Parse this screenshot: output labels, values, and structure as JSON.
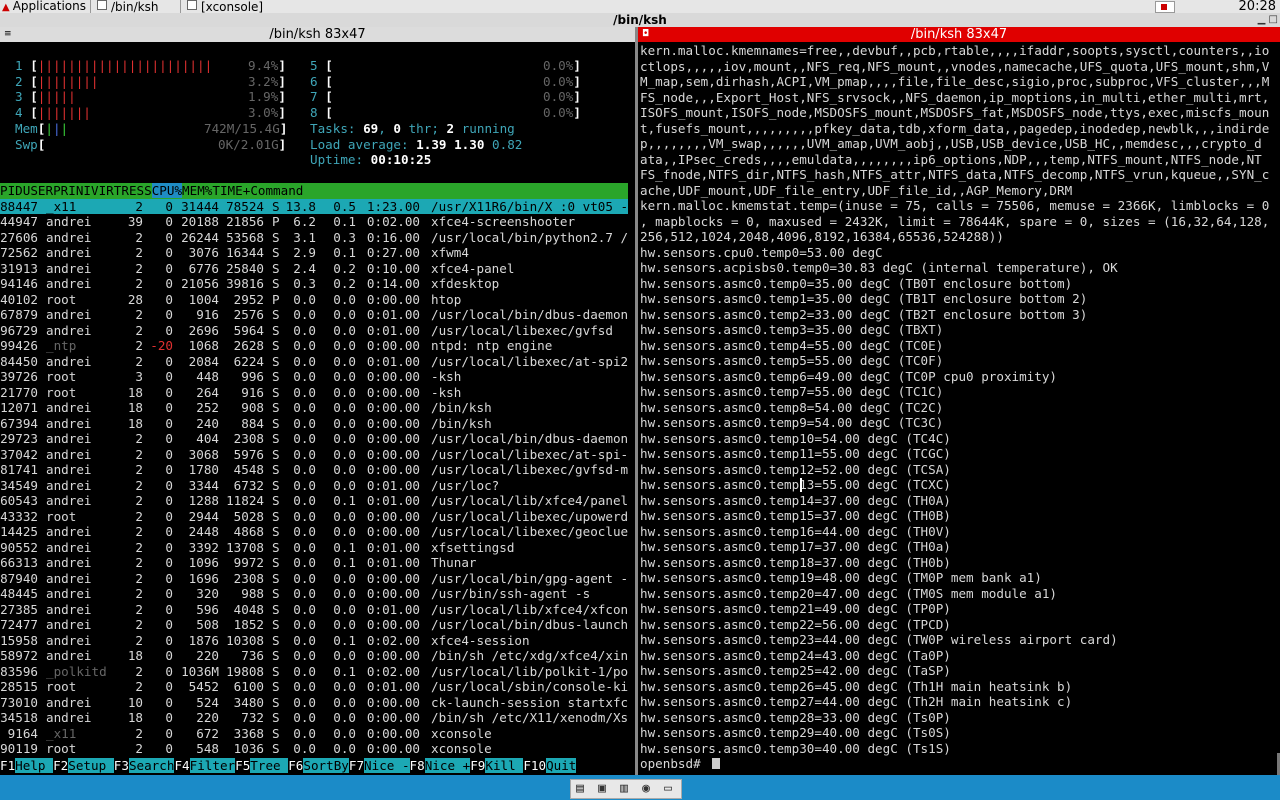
{
  "topbar": {
    "applications": "Applications",
    "tabs": [
      "/bin/ksh",
      "[xconsole]"
    ],
    "clock": "20:28"
  },
  "window": {
    "title": "/bin/ksh",
    "left_title": "/bin/ksh 83x47",
    "right_title": "/bin/ksh 83x47"
  },
  "htop": {
    "cpus": [
      {
        "n": "1",
        "pct": "9.4%"
      },
      {
        "n": "2",
        "pct": "3.2%"
      },
      {
        "n": "3",
        "pct": "1.9%"
      },
      {
        "n": "4",
        "pct": "3.0%"
      },
      {
        "n": "5",
        "pct": "0.0%"
      },
      {
        "n": "6",
        "pct": "0.0%"
      },
      {
        "n": "7",
        "pct": "0.0%"
      },
      {
        "n": "8",
        "pct": "0.0%"
      }
    ],
    "mem_label": "Mem",
    "mem_val": "742M/15.4G",
    "swp_label": "Swp",
    "swp_val": "0K/2.01G",
    "tasks_label": "Tasks: ",
    "tasks": "69",
    "thr": "0",
    "thr_label": " thr; ",
    "running": "2",
    "running_label": " running",
    "load_label": "Load average: ",
    "load1": "1.39",
    "load5": "1.30",
    "load15": "0.82",
    "uptime_label": "Uptime: ",
    "uptime": "00:10:25",
    "columns": [
      "PID",
      "USER",
      "PRI",
      "NI",
      "VIRT",
      "RES",
      "S",
      "CPU%",
      "MEM%",
      "TIME+",
      "Command"
    ],
    "rows": [
      [
        "88447",
        "_x11",
        "2",
        "0",
        "31444",
        "78524",
        "S",
        "13.8",
        "0.5",
        "1:23.00",
        "/usr/X11R6/bin/X :0 vt05 -"
      ],
      [
        "44947",
        "andrei",
        "39",
        "0",
        "20188",
        "21856",
        "P",
        "6.2",
        "0.1",
        "0:02.00",
        "xfce4-screenshooter"
      ],
      [
        "27606",
        "andrei",
        "2",
        "0",
        "26244",
        "53568",
        "S",
        "3.1",
        "0.3",
        "0:16.00",
        "/usr/local/bin/python2.7 /"
      ],
      [
        "72562",
        "andrei",
        "2",
        "0",
        "3076",
        "16344",
        "S",
        "2.9",
        "0.1",
        "0:27.00",
        "xfwm4"
      ],
      [
        "31913",
        "andrei",
        "2",
        "0",
        "6776",
        "25840",
        "S",
        "2.4",
        "0.2",
        "0:10.00",
        "xfce4-panel"
      ],
      [
        "94146",
        "andrei",
        "2",
        "0",
        "21056",
        "39816",
        "S",
        "0.3",
        "0.2",
        "0:14.00",
        "xfdesktop"
      ],
      [
        "40102",
        "root",
        "28",
        "0",
        "1004",
        "2952",
        "P",
        "0.0",
        "0.0",
        "0:00.00",
        "htop"
      ],
      [
        "67879",
        "andrei",
        "2",
        "0",
        "916",
        "2576",
        "S",
        "0.0",
        "0.0",
        "0:01.00",
        "/usr/local/bin/dbus-daemon"
      ],
      [
        "96729",
        "andrei",
        "2",
        "0",
        "2696",
        "5964",
        "S",
        "0.0",
        "0.0",
        "0:01.00",
        "/usr/local/libexec/gvfsd"
      ],
      [
        "99426",
        "_ntp",
        "2",
        "-20",
        "1068",
        "2628",
        "S",
        "0.0",
        "0.0",
        "0:00.00",
        "ntpd: ntp engine"
      ],
      [
        "84450",
        "andrei",
        "2",
        "0",
        "2084",
        "6224",
        "S",
        "0.0",
        "0.0",
        "0:01.00",
        "/usr/local/libexec/at-spi2"
      ],
      [
        "39726",
        "root",
        "3",
        "0",
        "448",
        "996",
        "S",
        "0.0",
        "0.0",
        "0:00.00",
        "-ksh"
      ],
      [
        "21770",
        "root",
        "18",
        "0",
        "264",
        "916",
        "S",
        "0.0",
        "0.0",
        "0:00.00",
        "-ksh"
      ],
      [
        "12071",
        "andrei",
        "18",
        "0",
        "252",
        "908",
        "S",
        "0.0",
        "0.0",
        "0:00.00",
        "/bin/ksh"
      ],
      [
        "67394",
        "andrei",
        "18",
        "0",
        "240",
        "884",
        "S",
        "0.0",
        "0.0",
        "0:00.00",
        "/bin/ksh"
      ],
      [
        "29723",
        "andrei",
        "2",
        "0",
        "404",
        "2308",
        "S",
        "0.0",
        "0.0",
        "0:00.00",
        "/usr/local/bin/dbus-daemon"
      ],
      [
        "37042",
        "andrei",
        "2",
        "0",
        "3068",
        "5976",
        "S",
        "0.0",
        "0.0",
        "0:00.00",
        "/usr/local/libexec/at-spi-"
      ],
      [
        "81741",
        "andrei",
        "2",
        "0",
        "1780",
        "4548",
        "S",
        "0.0",
        "0.0",
        "0:00.00",
        "/usr/local/libexec/gvfsd-m"
      ],
      [
        "34549",
        "andrei",
        "2",
        "0",
        "3344",
        "6732",
        "S",
        "0.0",
        "0.0",
        "0:01.00",
        "/usr/loc?"
      ],
      [
        "60543",
        "andrei",
        "2",
        "0",
        "1288",
        "11824",
        "S",
        "0.0",
        "0.1",
        "0:01.00",
        "/usr/local/lib/xfce4/panel"
      ],
      [
        "43332",
        "root",
        "2",
        "0",
        "2944",
        "5028",
        "S",
        "0.0",
        "0.0",
        "0:00.00",
        "/usr/local/libexec/upowerd"
      ],
      [
        "14425",
        "andrei",
        "2",
        "0",
        "2448",
        "4868",
        "S",
        "0.0",
        "0.0",
        "0:00.00",
        "/usr/local/libexec/geoclue"
      ],
      [
        "90552",
        "andrei",
        "2",
        "0",
        "3392",
        "13708",
        "S",
        "0.0",
        "0.1",
        "0:01.00",
        "xfsettingsd"
      ],
      [
        "66313",
        "andrei",
        "2",
        "0",
        "1096",
        "9972",
        "S",
        "0.0",
        "0.1",
        "0:01.00",
        "Thunar"
      ],
      [
        "87940",
        "andrei",
        "2",
        "0",
        "1696",
        "2308",
        "S",
        "0.0",
        "0.0",
        "0:00.00",
        "/usr/local/bin/gpg-agent -"
      ],
      [
        "48445",
        "andrei",
        "2",
        "0",
        "320",
        "988",
        "S",
        "0.0",
        "0.0",
        "0:00.00",
        "/usr/bin/ssh-agent -s"
      ],
      [
        "27385",
        "andrei",
        "2",
        "0",
        "596",
        "4048",
        "S",
        "0.0",
        "0.0",
        "0:01.00",
        "/usr/local/lib/xfce4/xfcon"
      ],
      [
        "72477",
        "andrei",
        "2",
        "0",
        "508",
        "1852",
        "S",
        "0.0",
        "0.0",
        "0:00.00",
        "/usr/local/bin/dbus-launch"
      ],
      [
        "15958",
        "andrei",
        "2",
        "0",
        "1876",
        "10308",
        "S",
        "0.0",
        "0.1",
        "0:02.00",
        "xfce4-session"
      ],
      [
        "58972",
        "andrei",
        "18",
        "0",
        "220",
        "736",
        "S",
        "0.0",
        "0.0",
        "0:00.00",
        "/bin/sh /etc/xdg/xfce4/xin"
      ],
      [
        "83596",
        "_polkitd",
        "2",
        "0",
        "1036M",
        "19808",
        "S",
        "0.0",
        "0.1",
        "0:02.00",
        "/usr/local/lib/polkit-1/po"
      ],
      [
        "28515",
        "root",
        "2",
        "0",
        "5452",
        "6100",
        "S",
        "0.0",
        "0.0",
        "0:01.00",
        "/usr/local/sbin/console-ki"
      ],
      [
        "73010",
        "andrei",
        "10",
        "0",
        "524",
        "3480",
        "S",
        "0.0",
        "0.0",
        "0:00.00",
        "ck-launch-session startxfc"
      ],
      [
        "34518",
        "andrei",
        "18",
        "0",
        "220",
        "732",
        "S",
        "0.0",
        "0.0",
        "0:00.00",
        "/bin/sh /etc/X11/xenodm/Xs"
      ],
      [
        "9164",
        "_x11",
        "2",
        "0",
        "672",
        "3368",
        "S",
        "0.0",
        "0.0",
        "0:00.00",
        "xconsole"
      ],
      [
        "90119",
        "root",
        "2",
        "0",
        "548",
        "1036",
        "S",
        "0.0",
        "0.0",
        "0:00.00",
        "xconsole"
      ]
    ],
    "fkeys": [
      {
        "k": "F1",
        "l": "Help  "
      },
      {
        "k": "F2",
        "l": "Setup "
      },
      {
        "k": "F3",
        "l": "Search"
      },
      {
        "k": "F4",
        "l": "Filter"
      },
      {
        "k": "F5",
        "l": "Tree  "
      },
      {
        "k": "F6",
        "l": "SortBy"
      },
      {
        "k": "F7",
        "l": "Nice -"
      },
      {
        "k": "F8",
        "l": "Nice +"
      },
      {
        "k": "F9",
        "l": "Kill  "
      },
      {
        "k": "F10",
        "l": "Quit  "
      }
    ]
  },
  "console_lines": [
    "kern.malloc.kmemnames=free,,devbuf,,pcb,rtable,,,,ifaddr,soopts,sysctl,counters,,io",
    "ctlops,,,,,iov,mount,,NFS_req,NFS_mount,,vnodes,namecache,UFS_quota,UFS_mount,shm,V",
    "M_map,sem,dirhash,ACPI,VM_pmap,,,,file,file_desc,sigio,proc,subproc,VFS_cluster,,,M",
    "FS_node,,,Export_Host,NFS_srvsock,,NFS_daemon,ip_moptions,in_multi,ether_multi,mrt,",
    "ISOFS_mount,ISOFS_node,MSDOSFS_mount,MSDOSFS_fat,MSDOSFS_node,ttys,exec,miscfs_moun",
    "t,fusefs_mount,,,,,,,,,pfkey_data,tdb,xform_data,,pagedep,inodedep,newblk,,,indirde",
    "p,,,,,,,,VM_swap,,,,,,UVM_amap,UVM_aobj,,USB,USB_device,USB_HC,,memdesc,,,crypto_d",
    "ata,,IPsec_creds,,,,emuldata,,,,,,,,ip6_options,NDP,,,temp,NTFS_mount,NTFS_node,NT",
    "FS_fnode,NTFS_dir,NTFS_hash,NTFS_attr,NTFS_data,NTFS_decomp,NTFS_vrun,kqueue,,SYN_c",
    "ache,UDF_mount,UDF_file_entry,UDF_file_id,,AGP_Memory,DRM",
    "kern.malloc.kmemstat.temp=(inuse = 75, calls = 75506, memuse = 2366K, limblocks = 0",
    ", mapblocks = 0, maxused = 2432K, limit = 78644K, spare = 0, sizes = (16,32,64,128,",
    "256,512,1024,2048,4096,8192,16384,65536,524288))",
    "hw.sensors.cpu0.temp0=53.00 degC",
    "hw.sensors.acpisbs0.temp0=30.83 degC (internal temperature), OK",
    "hw.sensors.asmc0.temp0=35.00 degC (TB0T enclosure bottom)",
    "hw.sensors.asmc0.temp1=35.00 degC (TB1T enclosure bottom 2)",
    "hw.sensors.asmc0.temp2=33.00 degC (TB2T enclosure bottom 3)",
    "hw.sensors.asmc0.temp3=35.00 degC (TBXT)",
    "hw.sensors.asmc0.temp4=55.00 degC (TC0E)",
    "hw.sensors.asmc0.temp5=55.00 degC (TC0F)",
    "hw.sensors.asmc0.temp6=49.00 degC (TC0P cpu0 proximity)",
    "hw.sensors.asmc0.temp7=55.00 degC (TC1C)",
    "hw.sensors.asmc0.temp8=54.00 degC (TC2C)",
    "hw.sensors.asmc0.temp9=54.00 degC (TC3C)",
    "hw.sensors.asmc0.temp10=54.00 degC (TC4C)",
    "hw.sensors.asmc0.temp11=55.00 degC (TCGC)",
    "hw.sensors.asmc0.temp12=52.00 degC (TCSA)",
    "hw.sensors.asmc0.temp13=55.00 degC (TCXC)",
    "hw.sensors.asmc0.temp14=37.00 degC (TH0A)",
    "hw.sensors.asmc0.temp15=37.00 degC (TH0B)",
    "hw.sensors.asmc0.temp16=44.00 degC (TH0V)",
    "hw.sensors.asmc0.temp17=37.00 degC (TH0a)",
    "hw.sensors.asmc0.temp18=37.00 degC (TH0b)",
    "hw.sensors.asmc0.temp19=48.00 degC (TM0P mem bank a1)",
    "hw.sensors.asmc0.temp20=47.00 degC (TM0S mem module a1)",
    "hw.sensors.asmc0.temp21=49.00 degC (TP0P)",
    "hw.sensors.asmc0.temp22=56.00 degC (TPCD)",
    "hw.sensors.asmc0.temp23=44.00 degC (TW0P wireless airport card)",
    "hw.sensors.asmc0.temp24=43.00 degC (Ta0P)",
    "hw.sensors.asmc0.temp25=42.00 degC (TaSP)",
    "hw.sensors.asmc0.temp26=45.00 degC (Th1H main heatsink b)",
    "hw.sensors.asmc0.temp27=44.00 degC (Th2H main heatsink c)",
    "hw.sensors.asmc0.temp28=33.00 degC (Ts0P)",
    "hw.sensors.asmc0.temp29=40.00 degC (Ts0S)",
    "hw.sensors.asmc0.temp30=40.00 degC (Ts1S)"
  ],
  "prompt": "openbsd# ",
  "taskbar_icons": [
    "file-manager-icon",
    "terminal-icon",
    "app-finder-icon",
    "web-browser-icon",
    "folder-icon"
  ]
}
